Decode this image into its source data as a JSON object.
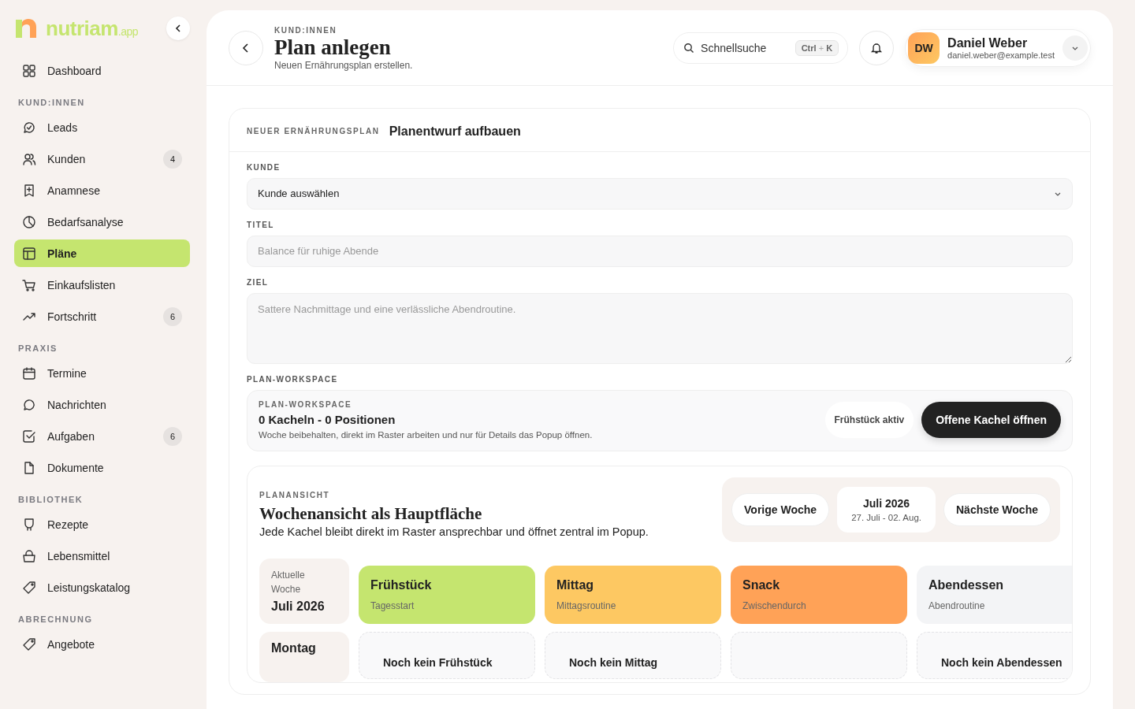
{
  "logo": {
    "name": "nutriam",
    "suffix": ".app"
  },
  "sidebar": {
    "top": [
      {
        "label": "Dashboard",
        "selected": false
      }
    ],
    "sections": [
      {
        "title": "KUND:INNEN",
        "items": [
          {
            "label": "Leads",
            "selected": false
          },
          {
            "label": "Kunden",
            "selected": false,
            "badge": "4"
          },
          {
            "label": "Anamnese",
            "selected": false
          },
          {
            "label": "Bedarfsanalyse",
            "selected": false
          },
          {
            "label": "Pläne",
            "selected": true
          },
          {
            "label": "Einkaufslisten",
            "selected": false
          },
          {
            "label": "Fortschritt",
            "selected": false,
            "badge": "6"
          }
        ]
      },
      {
        "title": "PRAXIS",
        "items": [
          {
            "label": "Termine",
            "selected": false
          },
          {
            "label": "Nachrichten",
            "selected": false
          },
          {
            "label": "Aufgaben",
            "selected": false,
            "badge": "6"
          },
          {
            "label": "Dokumente",
            "selected": false
          }
        ]
      },
      {
        "title": "BIBLIOTHEK",
        "items": [
          {
            "label": "Rezepte",
            "selected": false
          },
          {
            "label": "Lebensmittel",
            "selected": false
          },
          {
            "label": "Leistungskatalog",
            "selected": false
          }
        ]
      },
      {
        "title": "ABRECHNUNG",
        "items": [
          {
            "label": "Angebote",
            "selected": false
          }
        ]
      }
    ]
  },
  "header": {
    "eyebrow": "KUND:INNEN",
    "title": "Plan anlegen",
    "subtitle": "Neuen Ernährungsplan erstellen.",
    "search": {
      "placeholder": "Schnellsuche",
      "shortcut_key": "Ctrl",
      "shortcut_plus": "+",
      "shortcut_letter": "K"
    },
    "user": {
      "initials": "DW",
      "name": "Daniel Weber",
      "email": "daniel.weber@example.test"
    }
  },
  "form": {
    "eyebrow": "NEUER ERNÄHRUNGSPLAN",
    "title": "Planentwurf aufbauen",
    "customer": {
      "label": "KUNDE",
      "value": "Kunde auswählen"
    },
    "title_field": {
      "label": "TITEL",
      "placeholder": "Balance für ruhige Abende"
    },
    "goal": {
      "label": "ZIEL",
      "placeholder": "Sattere Nachmittage und eine verlässliche Abendroutine."
    },
    "workspace_label": "PLAN-WORKSPACE",
    "workspace": {
      "eyebrow": "PLAN-WORKSPACE",
      "summary": "0 Kacheln - 0 Positionen",
      "hint": "Woche beibehalten, direkt im Raster arbeiten und nur für Details das Popup öffnen.",
      "status": "Frühstück aktiv",
      "action": "Offene Kachel öffnen"
    }
  },
  "plan_view": {
    "eyebrow": "PLANANSICHT",
    "title": "Wochenansicht als Hauptfläche",
    "subtitle": "Jede Kachel bleibt direkt im Raster ansprechbar und öffnet zentral im Popup.",
    "prev": "Vorige Woche",
    "month": "Juli 2026",
    "range": "27. Juli - 02. Aug.",
    "next": "Nächste Woche",
    "week_label": "Aktuelle Woche",
    "week_value": "Juli 2026",
    "meals": [
      {
        "name": "Frühstück",
        "sub": "Tagesstart",
        "color": "#c5e56f"
      },
      {
        "name": "Mittag",
        "sub": "Mittagsroutine",
        "color": "#fdc862"
      },
      {
        "name": "Snack",
        "sub": "Zwischendurch",
        "color": "#ffa257"
      },
      {
        "name": "Abendessen",
        "sub": "Abendroutine",
        "color": "#f3f4f6"
      }
    ],
    "day": "Montag",
    "empty_slots": [
      "Noch kein Frühstück",
      "Noch kein Mittag",
      "Noch kein Abendessen"
    ]
  }
}
